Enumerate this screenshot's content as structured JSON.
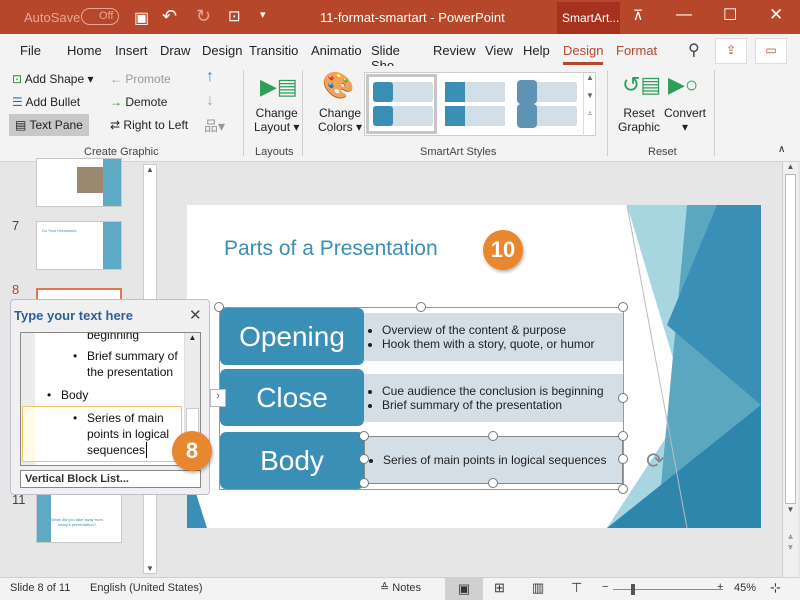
{
  "titlebar": {
    "autosave": "AutoSave",
    "autosave_state": "Off",
    "title": "11-format-smartart  -  PowerPoint",
    "context": "SmartArt..."
  },
  "tabs": [
    "File",
    "Home",
    "Insert",
    "Draw",
    "Design",
    "Transitio",
    "Animatio",
    "Slide Sho",
    "Review",
    "View",
    "Help",
    "Design",
    "Format"
  ],
  "active_tab": "Design",
  "ribbon": {
    "add_shape": "Add Shape",
    "add_bullet": "Add Bullet",
    "text_pane": "Text Pane",
    "promote": "Promote",
    "demote": "Demote",
    "right_to_left": "Right to Left",
    "create_graphic": "Create Graphic",
    "change_layout": "Change",
    "change_layout2": "Layout",
    "layouts": "Layouts",
    "change_colors": "Change",
    "change_colors2": "Colors",
    "smartart_styles": "SmartArt Styles",
    "reset_graphic": "Reset",
    "reset_graphic2": "Graphic",
    "convert": "Convert",
    "reset": "Reset"
  },
  "thumbs": {
    "n7": "7",
    "n8": "8",
    "n11": "11",
    "t7": "Do Your Homework",
    "t11": "What did you take away from today's presentation?"
  },
  "textpane": {
    "title": "Type your text here",
    "lines": [
      "beginning",
      "Brief summary of",
      "the presentation",
      "Body",
      "Series of main",
      "points in logical",
      "sequences"
    ],
    "footer": "Vertical Block List..."
  },
  "slide": {
    "title": "Parts of a Presentation",
    "rows": [
      {
        "label": "Opening",
        "bullets": [
          "Overview of the content & purpose",
          "Hook them with a story, quote, or humor"
        ]
      },
      {
        "label": "Close",
        "bullets": [
          "Cue audience the conclusion is beginning",
          "Brief summary of the presentation"
        ]
      },
      {
        "label": "Body",
        "bullets": [
          "Series of main points in logical sequences"
        ]
      }
    ]
  },
  "badges": {
    "b10": "10",
    "b8": "8"
  },
  "status": {
    "slide": "Slide 8 of 11",
    "lang": "English (United States)",
    "notes": "Notes",
    "zoom": "45%"
  },
  "colors": {
    "accent": "#b7472a",
    "smartart": "#3a8fb7",
    "badge": "#e8872e"
  }
}
